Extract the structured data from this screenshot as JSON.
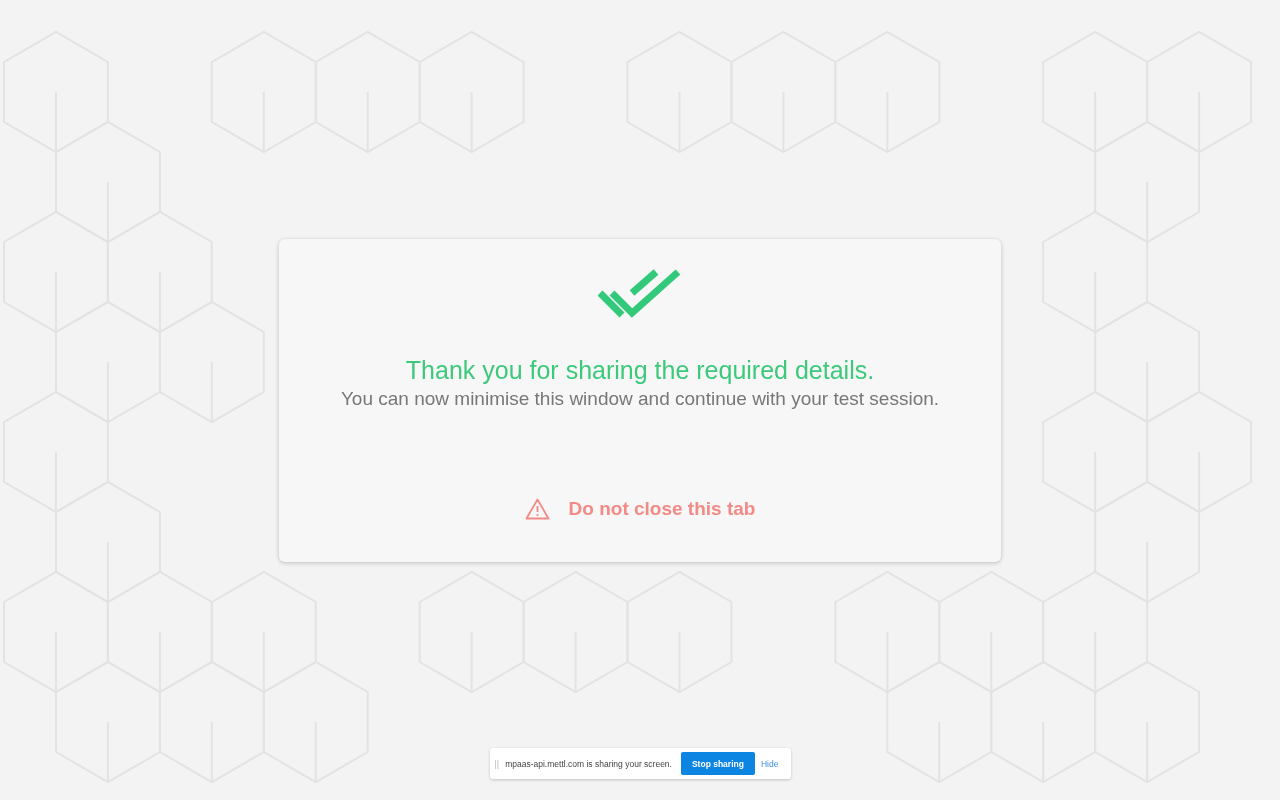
{
  "dialog": {
    "title": "Thank you for sharing the required details.",
    "message": "You can now minimise this window and continue with your test session.",
    "warning": "Do not close this tab"
  },
  "share_bar": {
    "grip": "||",
    "message": "mpaas-api.mettl.com is sharing your screen.",
    "buttons": [
      {
        "label": "Stop sharing",
        "kind": "primary"
      },
      {
        "label": "Hide",
        "kind": "link"
      }
    ]
  }
}
